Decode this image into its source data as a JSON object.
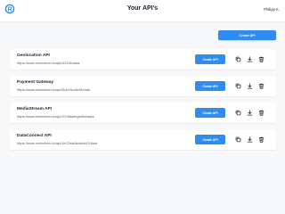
{
  "header": {
    "title": "Your API's",
    "user_name": "Philipp K.",
    "logo_icon": "circle-r-logo"
  },
  "toolbar": {
    "create_label": "Create API"
  },
  "apis": [
    {
      "name": "Geolocation API",
      "url": "https://www.nininsheet.io/api/1i224k/data",
      "button_label": "Create API"
    },
    {
      "name": "Payment Gateway",
      "url": "https://www.nininsheet.io/api/3k4i1fsd4e45/data",
      "button_label": "Create API"
    },
    {
      "name": "MediaStream API",
      "url": "https://www.nininsheet.io/api/1f14faadbgh6fsl/data",
      "button_label": "Create API"
    },
    {
      "name": "DataConnect API",
      "url": "https://www.nininsheet.io/api/1fn23sfs5sdefw43/data",
      "button_label": "Create API"
    }
  ],
  "row_icons": [
    "copy-icon",
    "download-icon",
    "trash-icon"
  ],
  "colors": {
    "accent": "#2f8cf0",
    "background": "#f7f8fa",
    "card": "#ffffff",
    "text": "#1a1f2b",
    "muted": "#5a6170"
  }
}
